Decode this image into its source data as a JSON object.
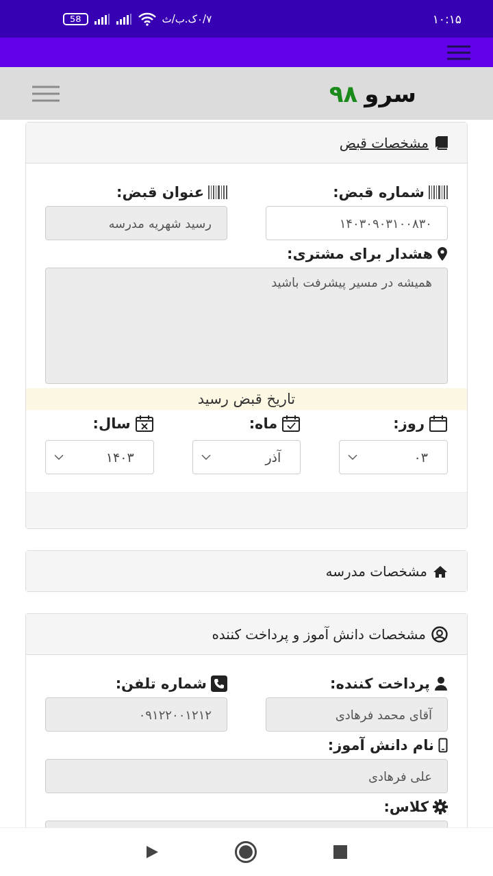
{
  "status_bar": {
    "time": "۱۰:۱۵",
    "network_speed": "۰/۷ک.ب/ث",
    "battery": "58"
  },
  "header": {
    "brand_name": "سرو",
    "brand_number": "۹۸"
  },
  "receipt_section": {
    "title": "مشخصات قبض",
    "fields": [
      {
        "label": "شماره قبض:",
        "value": "۱۴۰۳۰۹۰۳۱۰۰۸۳۰",
        "readonly": false
      },
      {
        "label": "عنوان قبض:",
        "value": "رسید شهریه مدرسه",
        "readonly": true
      }
    ],
    "warning": {
      "label": "هشدار برای مشتری:",
      "value": "همیشه در مسیر پیشرفت باشید",
      "readonly": true
    },
    "date_banner": "تاریخ قبض رسید",
    "date_selects": [
      {
        "label": "روز:",
        "value": "۰۳"
      },
      {
        "label": "ماه:",
        "value": "آذر"
      },
      {
        "label": "سال:",
        "value": "۱۴۰۳"
      }
    ]
  },
  "school_section": {
    "title": "مشخصات مدرسه"
  },
  "student_section": {
    "title": "مشخصات دانش آموز و پرداخت کننده",
    "fields": [
      {
        "label": "پرداخت کننده:",
        "value": "آقای محمد فرهادی",
        "readonly": true
      },
      {
        "label": "شماره تلفن:",
        "value": "۰۹۱۲۲۰۰۱۲۱۲",
        "readonly": true
      }
    ],
    "student_name": {
      "label": "نام دانش آموز:",
      "value": "علی فرهادی",
      "readonly": true
    },
    "class": {
      "label": "کلاس:",
      "readonly": true
    }
  }
}
